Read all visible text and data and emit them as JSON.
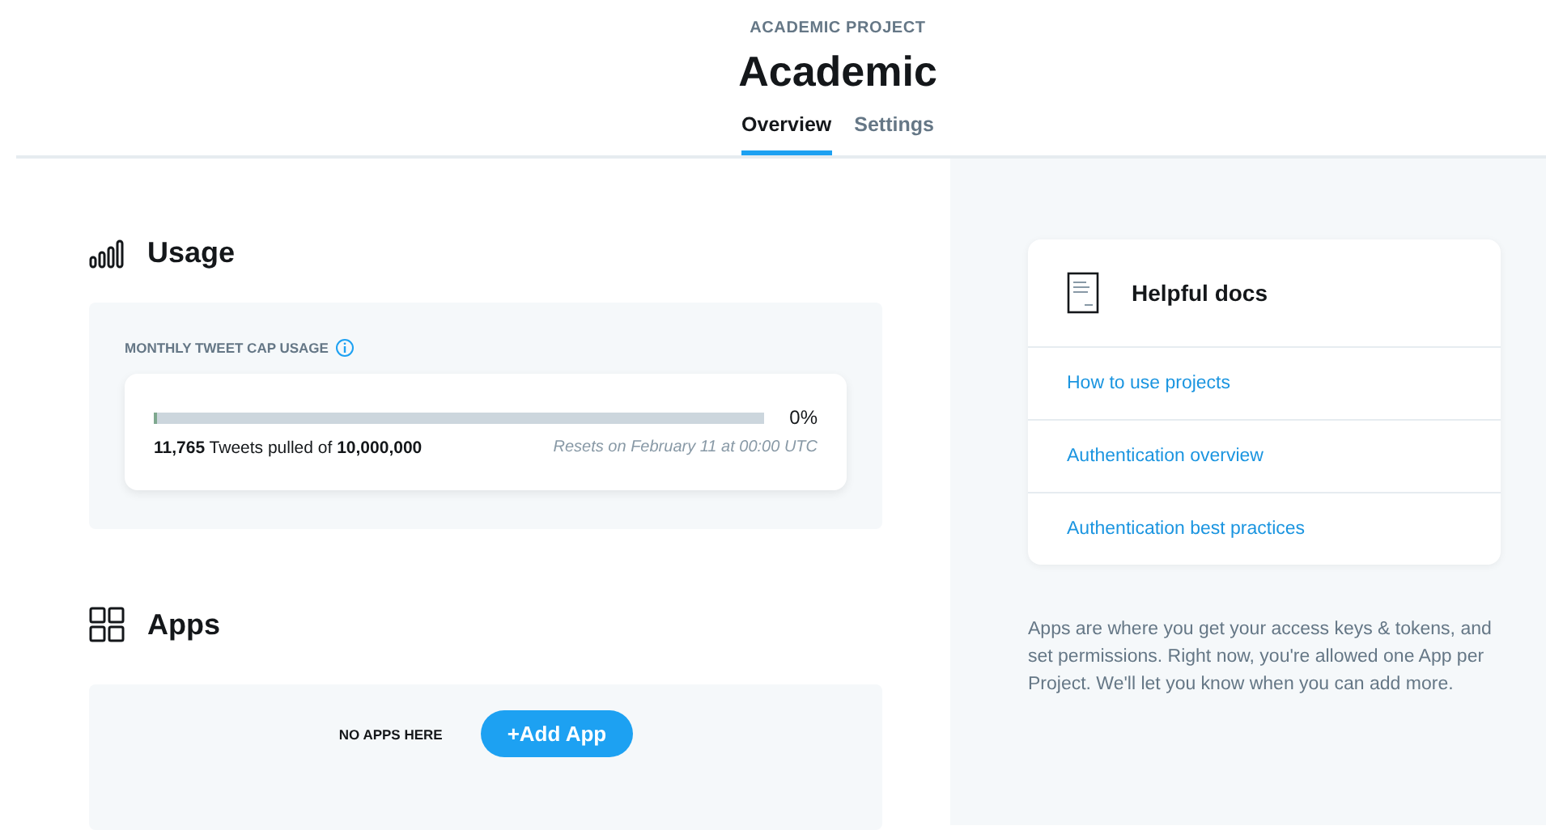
{
  "header": {
    "eyebrow": "ACADEMIC PROJECT",
    "title": "Academic"
  },
  "tabs": [
    {
      "label": "Overview",
      "selected": true
    },
    {
      "label": "Settings",
      "selected": false
    }
  ],
  "usage": {
    "title": "Usage",
    "meter_label": "MONTHLY TWEET CAP USAGE",
    "level": 0.0012,
    "percent": "0%",
    "stats": "**11,765** Tweets pulled of **10,000,000**",
    "reset": "Resets on February 11 at 00:00 UTC"
  },
  "apps": {
    "title": "Apps",
    "empty_text": "NO APPS HERE",
    "button": "+Add App"
  },
  "docs": {
    "title": "Helpful docs",
    "links": [
      "How to use projects",
      "Authentication overview",
      "Authentication best practices"
    ]
  },
  "apps_note": "Apps are where you get your access keys & tokens, and set permissions. Right now, you're allowed one App per Project. We'll let you know when you can add more."
}
